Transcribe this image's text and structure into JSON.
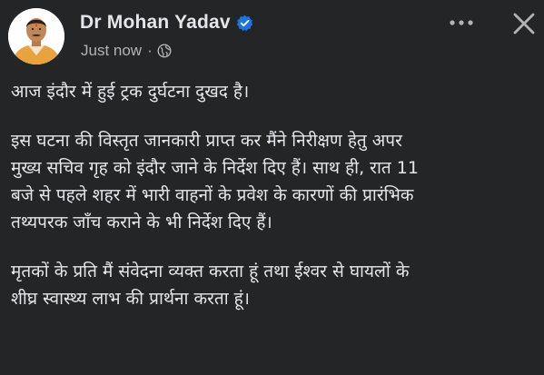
{
  "post": {
    "author": {
      "name": "Dr Mohan Yadav",
      "verified_icon": "verified-badge-icon"
    },
    "meta": {
      "timestamp": "Just now",
      "separator": "·",
      "audience_icon": "globe-icon"
    },
    "actions": {
      "more_icon": "more-options-icon",
      "close_icon": "close-icon"
    },
    "paragraphs": [
      "आज इंदौर में हुई ट्रक दुर्घटना दुखद है।",
      "इस घटना की विस्तृत जानकारी प्राप्त कर मैंने निरीक्षण हेतु अपर\nमुख्य सचिव गृह को इंदौर जाने के निर्देश दिए हैं। साथ ही, रात 11\nबजे से पहले शहर में भारी वाहनों के प्रवेश के कारणों की प्रारंभिक\nतथ्यपरक जाँच कराने के भी निर्देश दिए हैं।",
      "मृतकों के प्रति मैं संवेदना व्यक्त करता हूं तथा ईश्वर से घायलों के\nशीघ्र स्वास्थ्य लाभ की प्रार्थना करता हूं।"
    ]
  },
  "colors": {
    "background": "#242526",
    "primary_text": "#e4e6eb",
    "secondary_text": "#b0b3b8",
    "verified_blue": "#1b74e4"
  }
}
